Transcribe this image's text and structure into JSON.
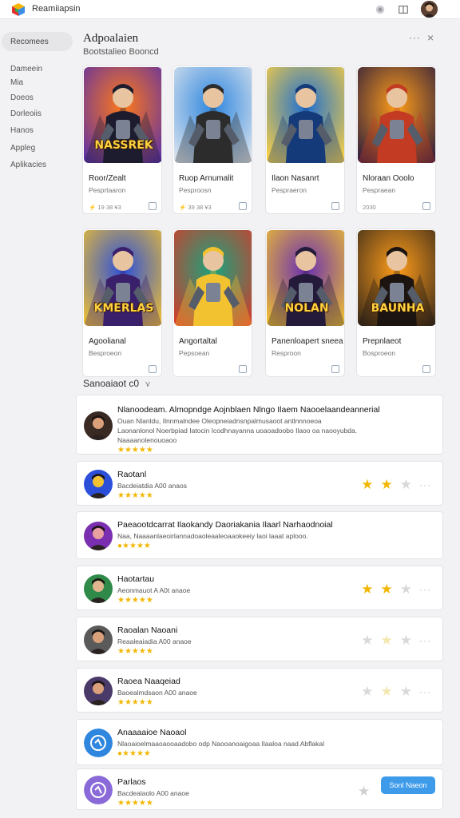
{
  "app": {
    "title": "Reamiiapsin",
    "icons": [
      "cube-logo-icon",
      "settings-icon",
      "split-icon"
    ]
  },
  "sidebar": {
    "active": "Recomees",
    "items": [
      "Dameein",
      "Mia",
      "Doeos",
      "Dorleoiis",
      "Hanos",
      "Appleg",
      "Aplikacies"
    ]
  },
  "main": {
    "title": "Adpoalaien",
    "subtitle": "Bootstalieo Booncd",
    "more": "···",
    "close": "×"
  },
  "cards": [
    {
      "name": "Roor/Zealt",
      "sub": "Pesprtaaron",
      "foot": "⚡ 19  38  ¥3",
      "art_title": "NASSREK",
      "palette": [
        "#ff7a1a",
        "#5b2fa8",
        "#1c1c2e"
      ]
    },
    {
      "name": "Ruop Arnumalit",
      "sub": "Pesproosn",
      "foot": "⚡ 39 38 ¥3",
      "art_title": "",
      "palette": [
        "#2e86de",
        "#dfe6ee",
        "#2c2c2c"
      ]
    },
    {
      "name": "Ilaon Nasanrt",
      "sub": "Pespraeron",
      "foot": "",
      "art_title": "",
      "palette": [
        "#1f6fd1",
        "#ffd23f",
        "#153a7a"
      ]
    },
    {
      "name": "Nloraan Ooolo",
      "sub": "Pespraean",
      "foot": "2030",
      "art_title": "",
      "palette": [
        "#ff9d1a",
        "#2a1b3d",
        "#c23b22"
      ]
    },
    {
      "name": "Agoolianal",
      "sub": "Besproeon",
      "foot": "",
      "art_title": "KMERLAS",
      "palette": [
        "#2b4fd9",
        "#f2c230",
        "#3a1f6b"
      ]
    },
    {
      "name": "Angortaltal",
      "sub": "Pepsoean",
      "foot": "",
      "art_title": "",
      "palette": [
        "#18a37d",
        "#d63a2a",
        "#f2c230"
      ]
    },
    {
      "name": "Panenloapert sneea",
      "sub": "Resproon",
      "foot": "",
      "art_title": "NOLAN",
      "palette": [
        "#6a2fb0",
        "#f2c230",
        "#241a3a"
      ]
    },
    {
      "name": "Prepnlaeot",
      "sub": "Bosproeon",
      "foot": "",
      "art_title": "BAUNHA",
      "palette": [
        "#ff9d1a",
        "#3a2a1a",
        "#1c1410"
      ]
    }
  ],
  "section": {
    "title": "Sanoaiaot c0",
    "arrow": "⋎"
  },
  "reviews": [
    {
      "title": "Nlanoodeam. Almopndge Aojnblaen Nlngo Ilaem Naooelaandeannerial",
      "lines": [
        "Ouan Nlanldu, Ilnnmalndee Oleopneiadnsnpalmusaoot antlnnnoeoa",
        "Laonanlonol Noerbpiad Iatocin Icodhnayanna uoaoadoobo Ilaoo oa naooyubda.",
        "Naaaanolenouoaoo"
      ],
      "stars": "★★★★★",
      "rating": []
    },
    {
      "title": "Raotanl",
      "lines": [
        "Bacdeiatdia A00 anaos"
      ],
      "stars": "★★★★★",
      "rating": [
        "★",
        "★",
        "★"
      ]
    },
    {
      "title": "Paeaootdcarrat Ilaokandy Daoriakania Ilaarl Narhaodnoial",
      "lines": [
        "Naa, Naaaanlaeoirlannadoaoleaaleoaaokeeiy laoi laaat aplooo."
      ],
      "stars": "●★★★★",
      "rating": []
    },
    {
      "title": "Haotartau",
      "lines": [
        "Aeonmauot A A0t anaoe"
      ],
      "stars": "★★★★★",
      "rating": [
        "★",
        "★",
        "★"
      ]
    },
    {
      "title": "Raoalan Naoani",
      "lines": [
        "Reaaleaiadia A00 anaoe"
      ],
      "stars": "★★★★★",
      "rating": [
        "★",
        "★",
        "★"
      ]
    },
    {
      "title": "Raoea Naaqeiad",
      "lines": [
        "Baoealmdsaon A00 anaoe"
      ],
      "stars": "★★★★★",
      "rating": [
        "★",
        "★",
        "★"
      ]
    },
    {
      "title": "Anaaaaioe Naoaol",
      "lines": [
        "Nlaoaioelmaaoaooaadobo odp Naooanoaigoaa Ilaaloa naad Abflakal"
      ],
      "stars": "●★★★★",
      "rating": []
    },
    {
      "title": "Parlaos",
      "lines": [
        "Bacdealaolo A00 anaoe"
      ],
      "stars": "★★★★★",
      "rating": [
        "★"
      ],
      "button": "Sonl Naeon"
    }
  ],
  "colors": {
    "accent": "#3d9be9",
    "star": "#f2b705",
    "star_dim": "#d9d9d9"
  }
}
